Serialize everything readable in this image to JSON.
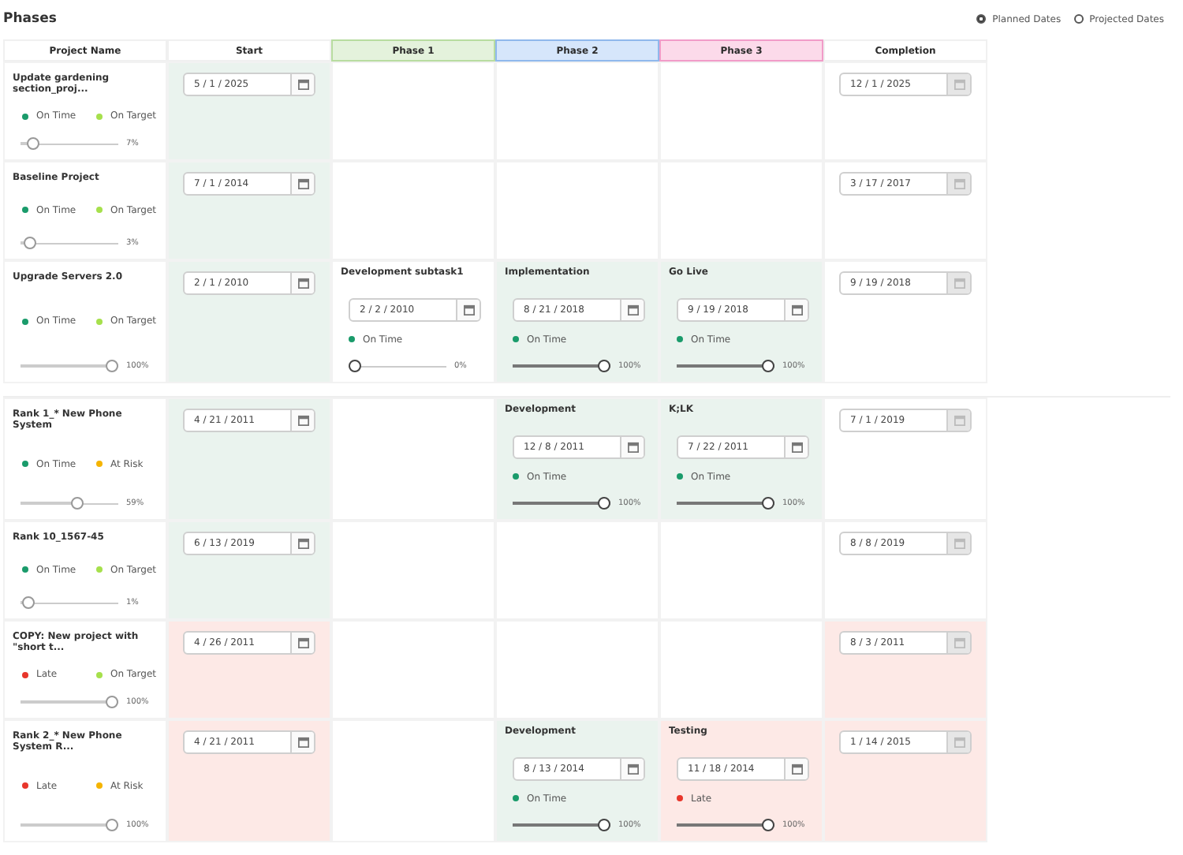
{
  "title": "Phases",
  "date_modes": [
    {
      "label": "Planned Dates",
      "selected": true
    },
    {
      "label": "Projected Dates",
      "selected": false
    }
  ],
  "columns": [
    {
      "label": "Project Name"
    },
    {
      "label": "Start"
    },
    {
      "label": "Phase 1",
      "color": "#e4f2dc"
    },
    {
      "label": "Phase 2",
      "color": "#d6e6fb"
    },
    {
      "label": "Phase 3",
      "color": "#fcdaea"
    },
    {
      "label": "Completion"
    }
  ],
  "rows": [
    {
      "name": "Update gardening section_proj...",
      "statuses": [
        {
          "label": "On Time",
          "color": "#1a9b6b"
        },
        {
          "label": "On Target",
          "color": "#a6e04c"
        }
      ],
      "level": 0.07,
      "percent": "7%",
      "start": {
        "date": "5 / 1 / 2025",
        "color": "#eaf3ee"
      },
      "phases": [
        {
          "kind": "empty"
        },
        {
          "kind": "empty"
        },
        {
          "kind": "empty"
        }
      ],
      "completion": {
        "date": "12 / 1 / 2025",
        "color": "#ffffff",
        "disabled": true
      }
    },
    {
      "name": "Baseline Project",
      "statuses": [
        {
          "label": "On Time",
          "color": "#1a9b6b"
        },
        {
          "label": "On Target",
          "color": "#a6e04c"
        }
      ],
      "level": 0.03,
      "percent": "3%",
      "start": {
        "date": "7 / 1 / 2014",
        "color": "#eaf3ee"
      },
      "phases": [
        {
          "kind": "empty"
        },
        {
          "kind": "empty"
        },
        {
          "kind": "empty"
        }
      ],
      "completion": {
        "date": "3 / 17 / 2017",
        "color": "#ffffff",
        "disabled": true
      }
    },
    {
      "name": "Upgrade Servers 2.0",
      "statuses": [
        {
          "label": "On Time",
          "color": "#1a9b6b"
        },
        {
          "label": "On Target",
          "color": "#a6e04c"
        }
      ],
      "level": 1,
      "percent": "100%",
      "start": {
        "date": "2 / 1 / 2010",
        "color": "#eaf3ee"
      },
      "phases": [
        {
          "kind": "task",
          "name": "Development subtask1",
          "date": "2 / 2 / 2010",
          "status": {
            "label": "On Time",
            "color": "#1a9b6b"
          },
          "level": 0,
          "percent": "0%",
          "color": "#ffffff"
        },
        {
          "kind": "task",
          "name": "Implementation",
          "date": "8 / 21 / 2018",
          "status": {
            "label": "On Time",
            "color": "#1a9b6b"
          },
          "level": 1,
          "percent": "100%",
          "color": "#eaf3ee"
        },
        {
          "kind": "task",
          "name": "Go Live",
          "date": "9 / 19 / 2018",
          "status": {
            "label": "On Time",
            "color": "#1a9b6b"
          },
          "level": 1,
          "percent": "100%",
          "color": "#eaf3ee"
        }
      ],
      "completion": {
        "date": "9 / 19 / 2018",
        "color": "#ffffff",
        "disabled": true
      }
    },
    {
      "break_before": true,
      "name": "Rank 1_* New Phone System",
      "statuses": [
        {
          "label": "On Time",
          "color": "#1a9b6b"
        },
        {
          "label": "At Risk",
          "color": "#f5b400"
        }
      ],
      "level": 0.59,
      "percent": "59%",
      "start": {
        "date": "4 / 21 / 2011",
        "color": "#eaf3ee"
      },
      "phases": [
        {
          "kind": "empty"
        },
        {
          "kind": "task",
          "name": "Development",
          "date": "12 / 8 / 2011",
          "status": {
            "label": "On Time",
            "color": "#1a9b6b"
          },
          "level": 1,
          "percent": "100%",
          "color": "#eaf3ee"
        },
        {
          "kind": "task",
          "name": "K;LK",
          "date": "7 / 22 / 2011",
          "status": {
            "label": "On Time",
            "color": "#1a9b6b"
          },
          "level": 1,
          "percent": "100%",
          "color": "#eaf3ee"
        }
      ],
      "completion": {
        "date": "7 / 1 / 2019",
        "color": "#ffffff",
        "disabled": true
      }
    },
    {
      "name": "Rank 10_1567-45",
      "statuses": [
        {
          "label": "On Time",
          "color": "#1a9b6b"
        },
        {
          "label": "On Target",
          "color": "#a6e04c"
        }
      ],
      "level": 0.01,
      "percent": "1%",
      "start": {
        "date": "6 / 13 / 2019",
        "color": "#eaf3ee"
      },
      "phases": [
        {
          "kind": "empty"
        },
        {
          "kind": "empty"
        },
        {
          "kind": "empty"
        }
      ],
      "completion": {
        "date": "8 / 8 / 2019",
        "color": "#ffffff",
        "disabled": true
      }
    },
    {
      "name": "COPY: New project with \"short t...",
      "statuses": [
        {
          "label": "Late",
          "color": "#e8362b"
        },
        {
          "label": "On Target",
          "color": "#a6e04c"
        }
      ],
      "level": 1,
      "percent": "100%",
      "start": {
        "date": "4 / 26 / 2011",
        "color": "#fde9e6"
      },
      "phases": [
        {
          "kind": "empty"
        },
        {
          "kind": "empty"
        },
        {
          "kind": "empty"
        }
      ],
      "completion": {
        "date": "8 / 3 / 2011",
        "color": "#fde9e6",
        "disabled": true
      }
    },
    {
      "name": "Rank 2_* New Phone System R...",
      "statuses": [
        {
          "label": "Late",
          "color": "#e8362b"
        },
        {
          "label": "At Risk",
          "color": "#f5b400"
        }
      ],
      "level": 1,
      "percent": "100%",
      "start": {
        "date": "4 / 21 / 2011",
        "color": "#fde9e6"
      },
      "phases": [
        {
          "kind": "empty"
        },
        {
          "kind": "task",
          "name": "Development",
          "date": "8 / 13 / 2014",
          "status": {
            "label": "On Time",
            "color": "#1a9b6b"
          },
          "level": 1,
          "percent": "100%",
          "color": "#eaf3ee"
        },
        {
          "kind": "task",
          "name": "Testing",
          "date": "11 / 18 / 2014",
          "status": {
            "label": "Late",
            "color": "#e8362b"
          },
          "level": 1,
          "percent": "100%",
          "color": "#fde9e6"
        }
      ],
      "completion": {
        "date": "1 / 14 / 2015",
        "color": "#fde9e6",
        "disabled": true
      }
    }
  ]
}
